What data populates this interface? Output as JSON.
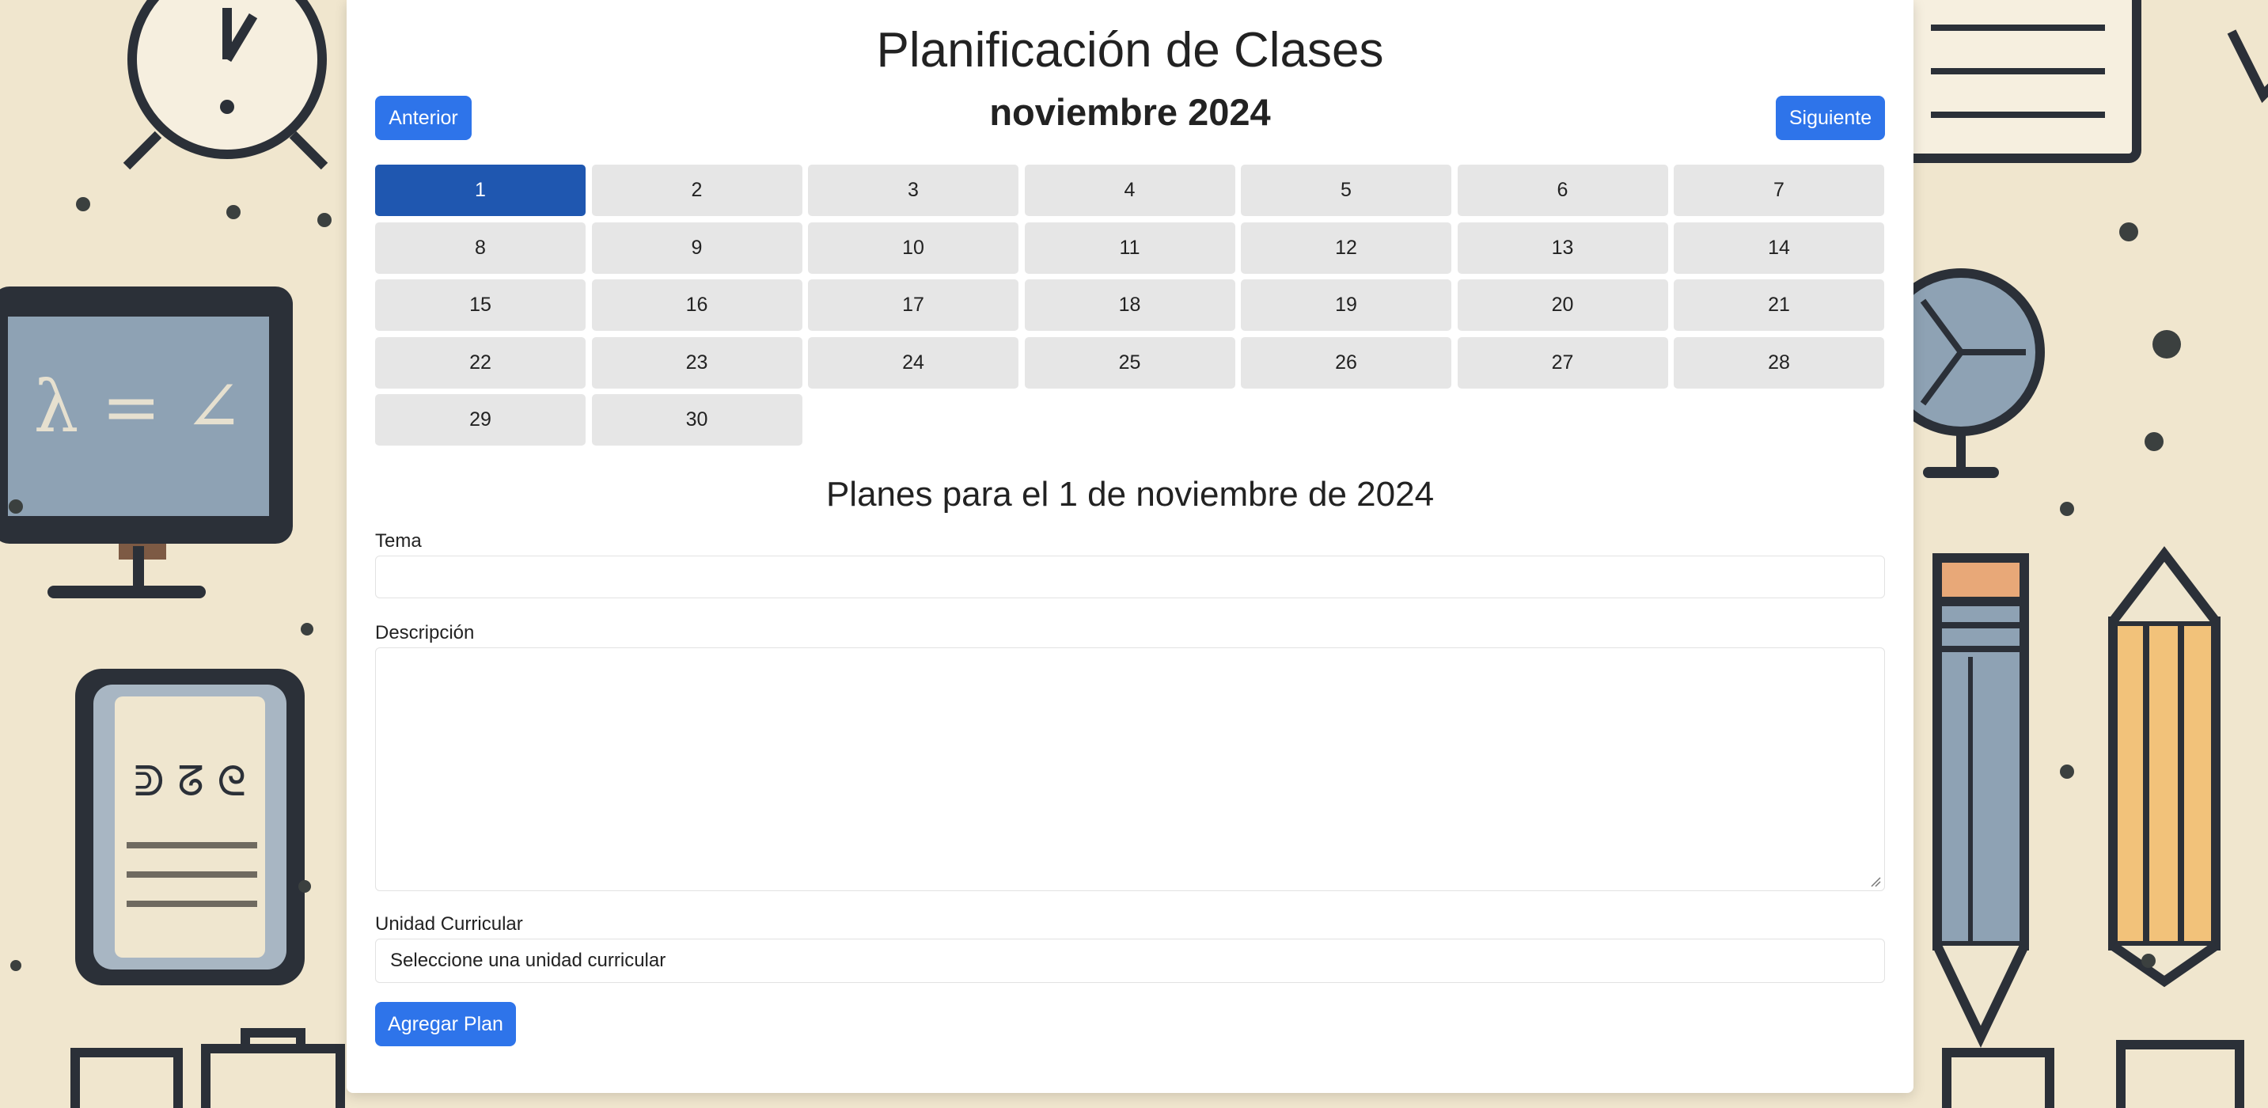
{
  "header": {
    "title": "Planificación de Clases",
    "month_label": "noviembre 2024",
    "prev_label": "Anterior",
    "next_label": "Siguiente"
  },
  "calendar": {
    "selected_day": "1",
    "days": [
      "1",
      "2",
      "3",
      "4",
      "5",
      "6",
      "7",
      "8",
      "9",
      "10",
      "11",
      "12",
      "13",
      "14",
      "15",
      "16",
      "17",
      "18",
      "19",
      "20",
      "21",
      "22",
      "23",
      "24",
      "25",
      "26",
      "27",
      "28",
      "29",
      "30"
    ]
  },
  "plans": {
    "title": "Planes para el 1 de noviembre de 2024",
    "tema_label": "Tema",
    "tema_value": "",
    "descripcion_label": "Descripción",
    "descripcion_value": "",
    "unidad_label": "Unidad Curricular",
    "unidad_selected": "Seleccione una unidad curricular",
    "add_label": "Agregar Plan"
  },
  "colors": {
    "primary": "#2e74ea",
    "selected_day": "#1f57b0",
    "day_bg": "#e6e6e6"
  }
}
